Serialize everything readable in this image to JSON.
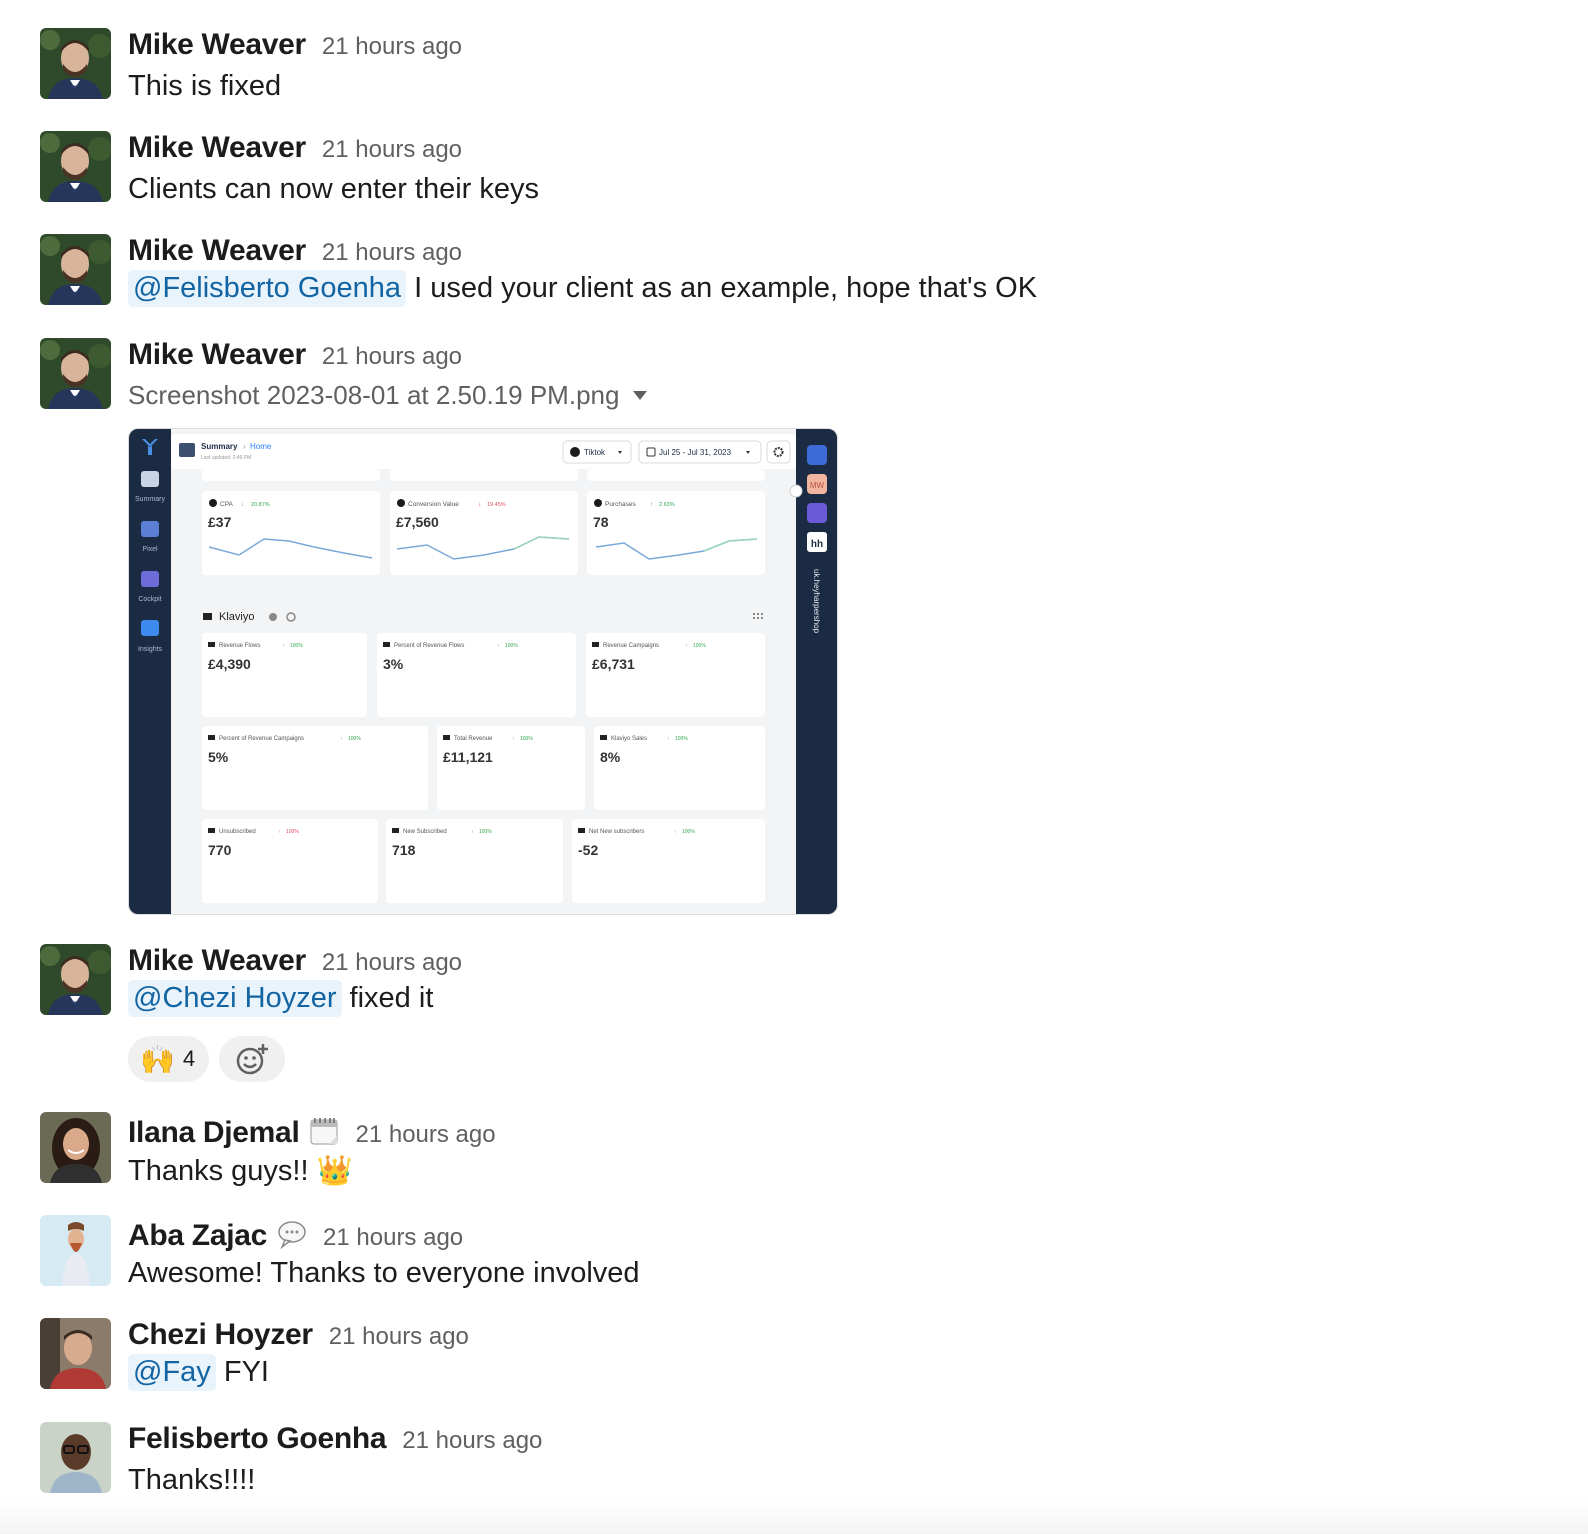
{
  "messages": [
    {
      "author": "Mike Weaver",
      "time": "21 hours ago",
      "text": "This is fixed"
    },
    {
      "author": "Mike Weaver",
      "time": "21 hours ago",
      "text": "Clients can now enter their keys"
    },
    {
      "author": "Mike Weaver",
      "time": "21 hours ago",
      "mention": "@Felisberto Goenha",
      "text": " I used your client as an example, hope that's OK"
    },
    {
      "author": "Mike Weaver",
      "time": "21 hours ago",
      "file_name": "Screenshot 2023-08-01 at 2.50.19 PM.png"
    },
    {
      "author": "Mike Weaver",
      "time": "21 hours ago",
      "mention": "@Chezi Hoyzer",
      "text": " fixed it",
      "reaction_emoji": "🙌",
      "reaction_count": "4"
    },
    {
      "author": "Ilana Djemal",
      "time": "21 hours ago",
      "text": "Thanks guys!! 👑",
      "status_icon": "calendar-icon"
    },
    {
      "author": "Aba Zajac",
      "time": "21 hours ago",
      "text": "Awesome! Thanks to everyone involved",
      "status_icon": "speech-bubble-icon"
    },
    {
      "author": "Chezi Hoyzer",
      "time": "21 hours ago",
      "mention": "@Fay",
      "text": " FYI"
    },
    {
      "author": "Felisberto Goenha",
      "time": "21 hours ago",
      "text": "Thanks!!!!"
    }
  ],
  "embedded_screenshot": {
    "breadcrumb_root": "Summary",
    "breadcrumb_current": "Home",
    "last_updated": "Last updated: 2:49 PM",
    "platform_select": "Tiktok",
    "date_range": "Jul 25 - Jul 31, 2023",
    "nav": [
      "Summary",
      "Pixel",
      "Cockpit",
      "Insights"
    ],
    "right_rail_label": "uk.heyharpershop",
    "right_rail_badge": "MW",
    "right_rail_logo": "hh",
    "top_cards": [
      {
        "label": "CPA",
        "change": "20.87%",
        "value": "£37",
        "trend": "up"
      },
      {
        "label": "Conversion Value",
        "change": "19.45%",
        "value": "£7,560",
        "trend": "down"
      },
      {
        "label": "Purchases",
        "change": "2.63%",
        "value": "78",
        "trend": "up"
      }
    ],
    "section_title": "Klaviyo",
    "klaviyo_row1": [
      {
        "label": "Revenue Flows",
        "change": "100%",
        "value": "£4,390"
      },
      {
        "label": "Percent of Revenue Flows",
        "change": "100%",
        "value": "3%"
      },
      {
        "label": "Revenue Campaigns",
        "change": "100%",
        "value": "£6,731"
      }
    ],
    "klaviyo_row2": [
      {
        "label": "Percent of Revenue Campaigns",
        "change": "100%",
        "value": "5%"
      },
      {
        "label": "Total Revenue",
        "change": "100%",
        "value": "£11,121"
      },
      {
        "label": "Klaviyo Sales",
        "change": "100%",
        "value": "8%"
      }
    ],
    "klaviyo_row3": [
      {
        "label": "Unsubscribed",
        "change": "100%",
        "value": "770",
        "trend": "down"
      },
      {
        "label": "New Subscribed",
        "change": "100%",
        "value": "718"
      },
      {
        "label": "Net New subscribers",
        "change": "100%",
        "value": "-52"
      }
    ]
  },
  "colors": {
    "mention_bg": "#e8f3fb",
    "mention_text": "#1264a3",
    "sidebar": "#1b2b44",
    "accent": "#2d7ff9"
  }
}
